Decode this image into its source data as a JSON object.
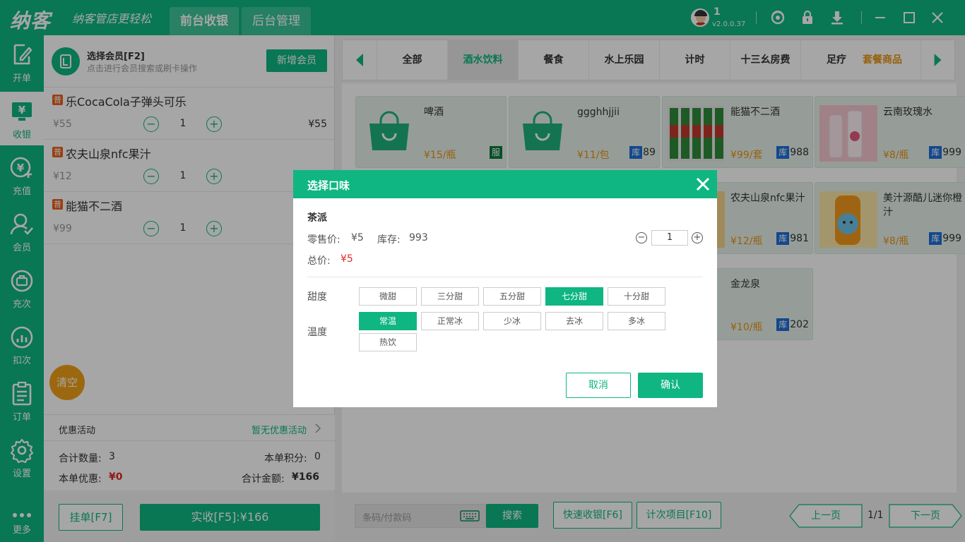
{
  "app": {
    "logo": "纳客",
    "slogan": "纳客管店更轻松",
    "tabs": [
      {
        "label": "前台收银"
      },
      {
        "label": "后台管理"
      }
    ],
    "user": {
      "name": "1",
      "version": "v2.0.0.37"
    }
  },
  "nav": [
    {
      "label": "开单",
      "icon": "edit-icon"
    },
    {
      "label": "收银",
      "icon": "cashier-icon"
    },
    {
      "label": "充值",
      "icon": "recharge-icon"
    },
    {
      "label": "会员",
      "icon": "member-icon"
    },
    {
      "label": "充次",
      "icon": "count-recharge-icon"
    },
    {
      "label": "扣次",
      "icon": "deduct-icon"
    },
    {
      "label": "订单",
      "icon": "order-icon"
    },
    {
      "label": "设置",
      "icon": "gear-icon"
    },
    {
      "label": "更多",
      "icon": "more-icon"
    }
  ],
  "cart": {
    "member_title": "选择会员[F2]",
    "member_sub": "点击进行会员搜索或刷卡操作",
    "add_member": "新增会员",
    "badge": "普",
    "items": [
      {
        "name": "乐CocaCola子弹头可乐",
        "price": "¥55",
        "qty": "1",
        "total": "¥55"
      },
      {
        "name": "农夫山泉nfc果汁",
        "price": "¥12",
        "qty": "1",
        "total": ""
      },
      {
        "name": "能猫不二酒",
        "price": "¥99",
        "qty": "1",
        "total": ""
      }
    ],
    "clear": "清空",
    "promo_label": "优惠活动",
    "promo_value": "暂无优惠活动",
    "total_qty_label": "合计数量:",
    "total_qty": "3",
    "points_label": "本单积分:",
    "points": "0",
    "discount_label": "本单优惠:",
    "discount": "¥0",
    "amount_label": "合计金额:",
    "amount": "¥166",
    "hold": "挂单[F7]",
    "pay": "实收[F5]:¥166"
  },
  "categories": {
    "tabs": [
      "全部",
      "酒水饮料",
      "餐食",
      "水上乐园",
      "计时",
      "十三幺房费",
      "足疗"
    ],
    "extra": "套餐商品"
  },
  "products": [
    {
      "name": "啤酒",
      "price": "¥15/瓶",
      "tag": "服",
      "stock": ""
    },
    {
      "name": "ggghhjjii",
      "price": "¥11/包",
      "tag": "库",
      "stock": "89"
    },
    {
      "name": "能猫不二酒",
      "price": "¥99/套",
      "tag": "库",
      "stock": "988"
    },
    {
      "name": "云南玫瑰水",
      "price": "¥8/瓶",
      "tag": "库",
      "stock": "999"
    },
    {
      "name": "农夫山泉nfc果汁",
      "price": "¥12/瓶",
      "tag": "库",
      "stock": "981"
    },
    {
      "name": "美汁源酷儿迷你橙汁",
      "price": "¥8/瓶",
      "tag": "库",
      "stock": "999"
    },
    {
      "name": "金龙泉",
      "price": "¥10/瓶",
      "tag": "库",
      "stock": "202"
    }
  ],
  "bottom": {
    "search_placeholder": "条码/付款码",
    "search_btn": "搜索",
    "quick_pay": "快速收银[F6]",
    "count_items": "计次项目[F10]",
    "prev": "上一页",
    "page": "1/1",
    "next": "下一页"
  },
  "modal": {
    "title": "选择口味",
    "product": "茶派",
    "price_label": "零售价:",
    "price": "¥5",
    "stock_label": "库存:",
    "stock": "993",
    "total_label": "总价:",
    "total": "¥5",
    "qty": "1",
    "sweet_label": "甜度",
    "sweet_options": [
      "微甜",
      "三分甜",
      "五分甜",
      "七分甜",
      "十分甜"
    ],
    "sweet_selected": "七分甜",
    "temp_label": "温度",
    "temp_options": [
      "常温",
      "正常冰",
      "少冰",
      "去冰",
      "多冰",
      "热饮"
    ],
    "temp_selected": "常温",
    "cancel": "取消",
    "confirm": "确认"
  },
  "colors": {
    "brand": "#0fb681",
    "price": "#e89410",
    "danger": "#e02a2a",
    "stock_tag": "#1e6fd9"
  }
}
